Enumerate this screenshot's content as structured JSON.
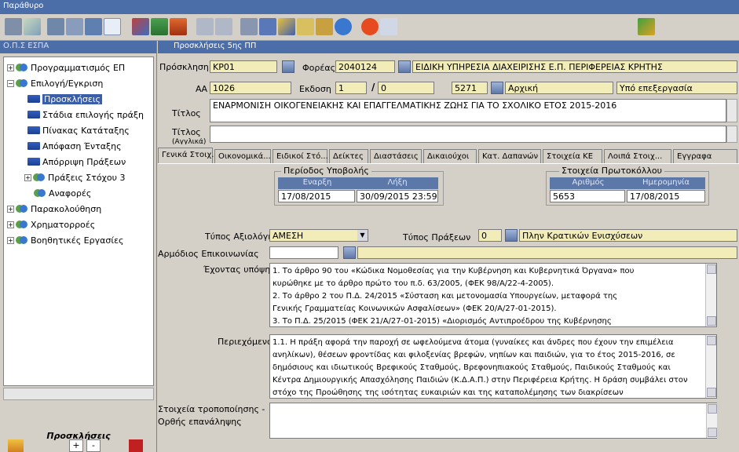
{
  "window": {
    "title": "Παράθυρο"
  },
  "sidebar": {
    "title": "Ο.Π.Σ ΕΣΠΑ",
    "footer_label": "Προσκλήσεις",
    "tree": [
      {
        "label": "Προγραμματισμός ΕΠ"
      },
      {
        "label": "Επιλογή/Εγκριση"
      },
      {
        "label": "Προσκλήσεις"
      },
      {
        "label": "Στάδια επιλογής πράξη"
      },
      {
        "label": "Πίνακας Κατάταξης"
      },
      {
        "label": "Απόφαση Ένταξης"
      },
      {
        "label": "Απόρριψη Πράξεων"
      },
      {
        "label": "Πράξεις Στόχου 3"
      },
      {
        "label": "Αναφορές"
      },
      {
        "label": "Παρακολούθηση"
      },
      {
        "label": "Χρηματορροές"
      },
      {
        "label": "Βοηθητικές Εργασίες"
      }
    ],
    "buttons": {
      "add": "+",
      "remove": "-"
    }
  },
  "form": {
    "title": "Προσκλήσεις 5ης ΠΠ",
    "fields": {
      "proskl_label": "Πρόσκληση",
      "proskl": "ΚΡ01",
      "foreas_label": "Φορέας",
      "foreas_code": "2040124",
      "foreas_name": "ΕΙΔΙΚΗ ΥΠΗΡΕΣΙΑ ΔΙΑΧΕΙΡΙΣΗΣ Ε.Π. ΠΕΡΙΦΕΡΕΙΑΣ ΚΡΗΤΗΣ",
      "aa_label": "ΑΑ",
      "aa": "1026",
      "ekdosi_label": "Εκδοση",
      "ekdosi": "1",
      "slash": "/",
      "ekdosi2": "0",
      "code2": "5271",
      "status1": "Αρχική",
      "status2": "Υπό επεξεργασία",
      "titlos_label": "Τίτλος",
      "titlos": "ΕΝΑΡΜΟΝΙΣΗ ΟΙΚΟΓΕΝΕΙΑΚΗΣ ΚΑΙ ΕΠΑΓΓΕΛΜΑΤΙΚΗΣ ΖΩΗΣ ΓΙΑ ΤΟ ΣΧΟΛΙΚΟ ΕΤΟΣ 2015-2016",
      "titlos2_label": "Τίτλος",
      "titlos2_sub": "(Αγγλικά)",
      "titlos2": ""
    },
    "tabs": [
      "Γενικά Στοιχ...",
      "Οικονομικά...",
      "Ειδικοί Στό...",
      "Δείκτες",
      "Διαστάσεις",
      "Δικαιούχοι",
      "Κατ. Δαπανών",
      "Στοιχεία ΚΕ",
      "Λοιπά Στοιχ...",
      "Εγγραφα"
    ],
    "period": {
      "title": "Περίοδος Υποβολής",
      "start_h": "Εναρξη",
      "end_h": "Λήξη",
      "start": "17/08/2015",
      "end": "30/09/2015 23:59"
    },
    "protocol": {
      "title": "Στοιχεία Πρωτοκόλλου",
      "num_h": "Αριθμός",
      "date_h": "Ημερομηνία",
      "num": "5653",
      "date": "17/08/2015"
    },
    "eval_label": "Τύπος Αξιολόγησης",
    "eval": "ΑΜΕΣΗ",
    "praxi_label": "Τύπος Πράξεων",
    "praxi_code": "0",
    "praxi_name": "Πλην Κρατικών Ενισχύσεων",
    "contact_label": "Αρμόδιος Επικοινωνίας",
    "contact": "",
    "considering_label": "Έχοντας υπόψη",
    "considering": [
      "1. Το άρθρο 90 του «Κώδικα Νομοθεσίας για την Κυβέρνηση και Κυβερνητικά Όργανα» που",
      "κυρώθηκε με το άρθρο πρώτο του π.δ. 63/2005, (ΦΕΚ 98/Α/22-4-2005).",
      "2. Το άρθρο 2 του Π.Δ. 24/2015 «Σύσταση και μετονομασία Υπουργείων, μεταφορά της",
      "Γενικής Γραμματείας Κοινωνικών Ασφαλίσεων» (ΦΕΚ 20/Α/27-01-2015).",
      "3. Το Π.Δ. 25/2015 (ΦΕΚ 21/Α/27-01-2015) «Διορισμός Αντιπροέδρου της Κυβέρνησης"
    ],
    "content_label": "Περιεχόμενο",
    "content": [
      "1.1. Η πράξη αφορά την παροχή σε ωφελούμενα άτομα (γυναίκες και άνδρες που έχουν την επιμέλεια",
      "ανηλίκων), θέσεων φροντίδας και φιλοξενίας βρεφών, νηπίων και παιδιών, για το έτος 2015-2016, σε",
      "δημόσιους και ιδιωτικούς Βρεφικούς Σταθμούς, Βρεφονηπιακούς Σταθμούς, Παιδικούς Σταθμούς και",
      "Κέντρα Δημιουργικής Απασχόλησης Παιδιών (Κ.Δ.Α.Π.) στην Περιφέρεια Κρήτης. Η δράση συμβάλει στον",
      "στόχο της Προώθησης της ισότητας ευκαιριών και της καταπολέμησης των διακρίσεων"
    ],
    "mods_label1": "Στοιχεία τροποποίησης -",
    "mods_label2": "Ορθής επανάληψης",
    "mods": ""
  }
}
